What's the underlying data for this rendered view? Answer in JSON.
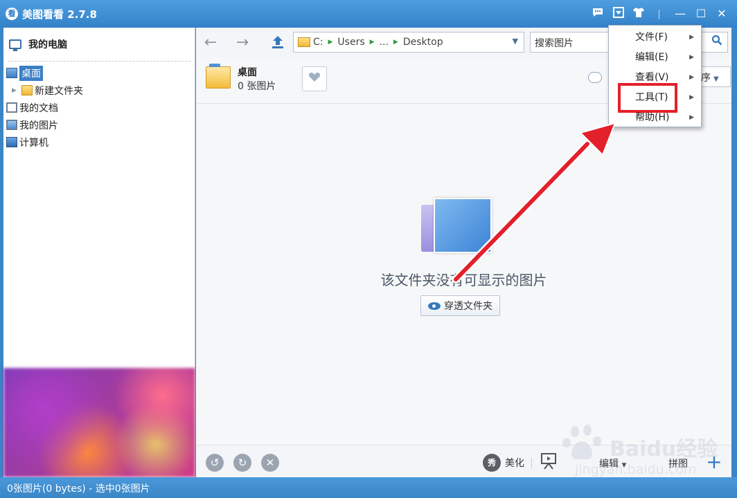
{
  "app": {
    "logo_glyph": "看",
    "title": "美图看看 2.7.8"
  },
  "titlebar": {
    "feedback_icon": "chat-icon",
    "menu_icon": "dropdown-icon",
    "skin_icon": "tshirt-icon",
    "minimize": "—",
    "maximize": "☐",
    "close": "✕"
  },
  "sidebar": {
    "header": "我的电脑",
    "tree": [
      {
        "label": "桌面",
        "icon": "desktop-icon",
        "selected": true
      },
      {
        "label": "新建文件夹",
        "icon": "folder-icon",
        "child": true
      },
      {
        "label": "我的文档",
        "icon": "document-icon"
      },
      {
        "label": "我的图片",
        "icon": "pictures-icon"
      },
      {
        "label": "计算机",
        "icon": "computer-icon"
      }
    ]
  },
  "toolbar": {
    "back": "←",
    "forward": "→",
    "up": "⇧",
    "address": {
      "drive": "C:",
      "crumbs": [
        "Users",
        "...",
        "Desktop"
      ]
    },
    "search_placeholder": "搜索图片"
  },
  "folder": {
    "name": "桌面",
    "count": "0 张图片",
    "sort_label": "序"
  },
  "empty": {
    "message": "该文件夹没有可显示的图片",
    "pierce_button": "穿透文件夹"
  },
  "bottombar": {
    "rotate_left": "↺",
    "rotate_right": "↻",
    "delete": "✕",
    "beauty_badge": "秀",
    "beauty": "美化",
    "edit": "编辑",
    "puzzle": "拼图",
    "add": "+"
  },
  "status": "0张图片(0 bytes) - 选中0张图片",
  "menu": {
    "items": [
      "文件(F)",
      "编辑(E)",
      "查看(V)",
      "工具(T)",
      "帮助(H)"
    ],
    "highlighted": "工具(T)"
  },
  "annotation": {
    "arrow_color": "#e3202b"
  },
  "watermark": {
    "brand": "Baidu经验",
    "url": "jingyan.baidu.com"
  }
}
